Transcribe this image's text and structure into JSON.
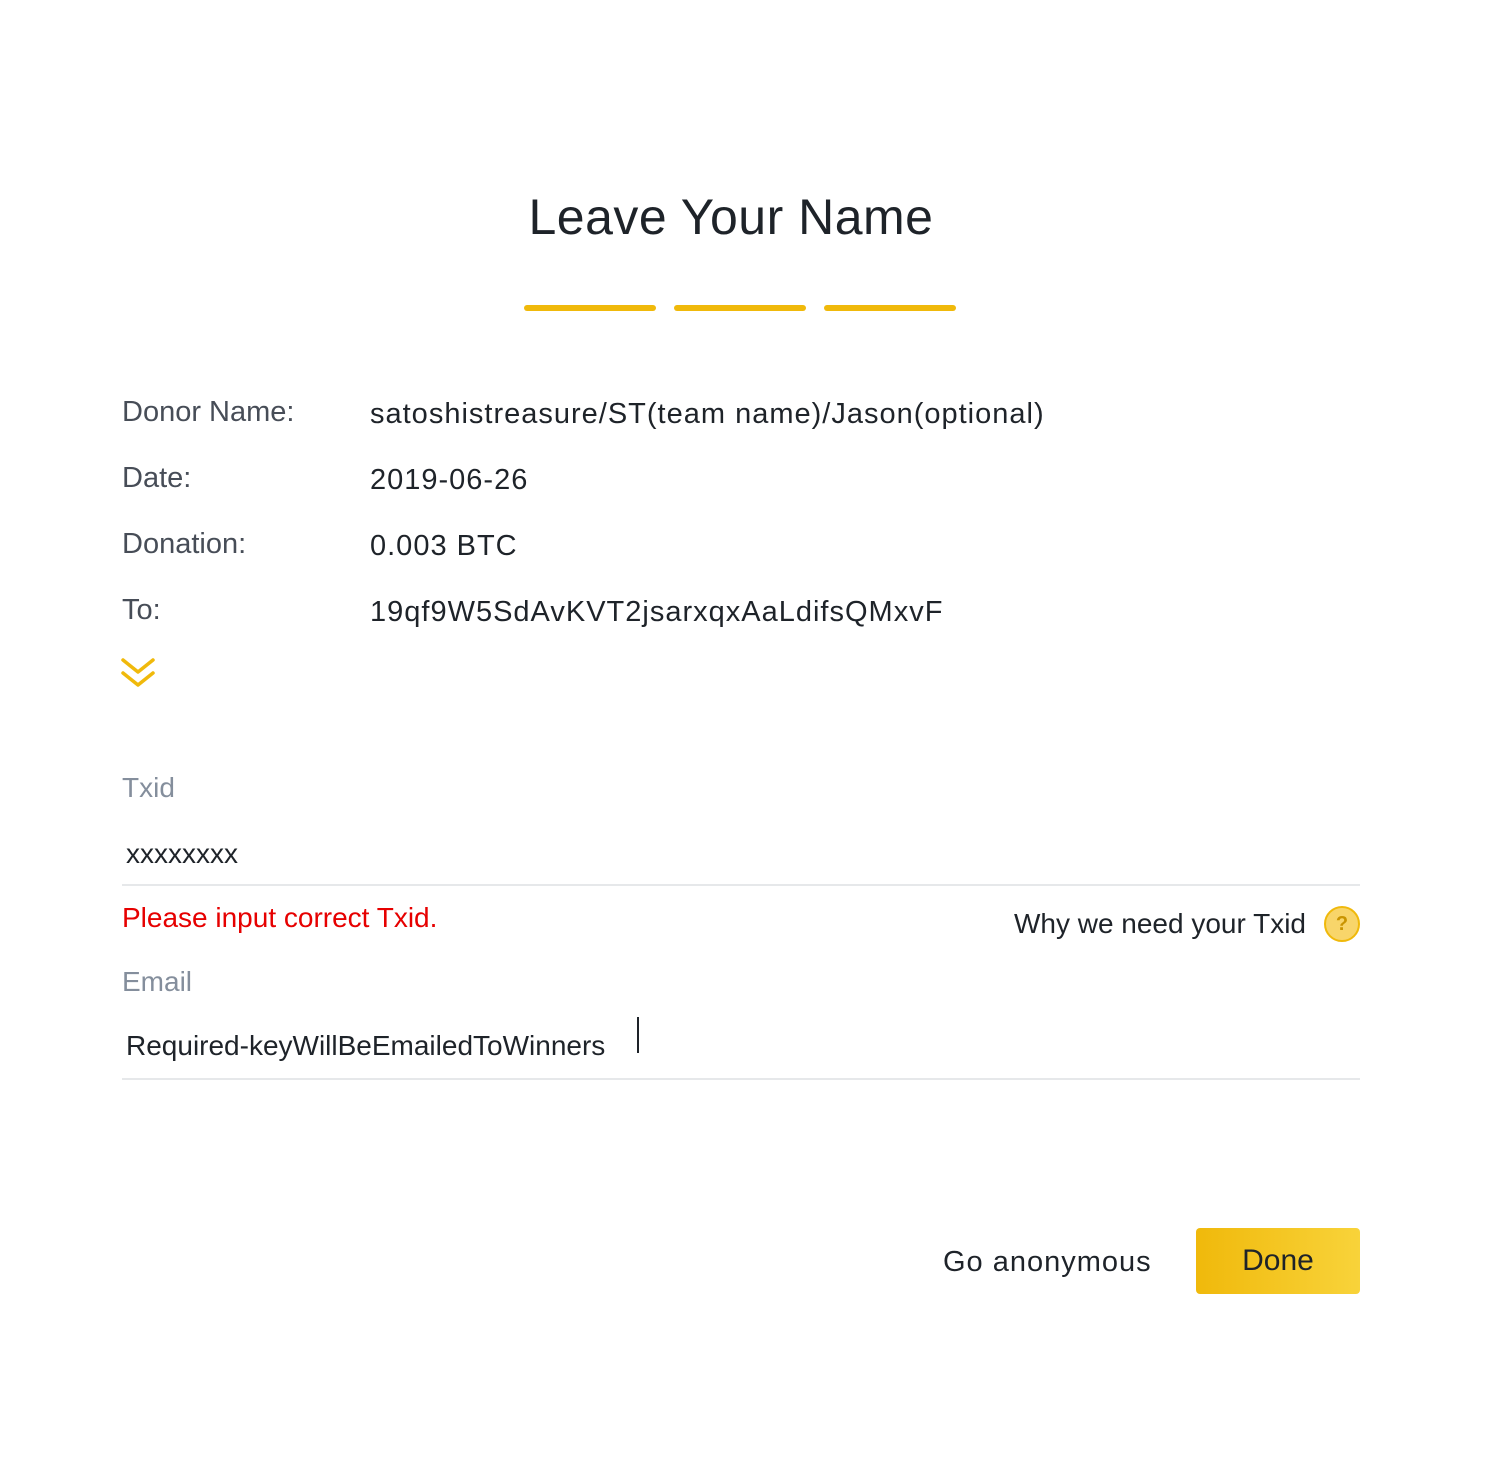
{
  "title": "Leave Your Name",
  "progress": {
    "total_steps": 3,
    "completed_steps": 3,
    "accent_color": "#f0b90b"
  },
  "info": [
    {
      "label": "Donor Name:",
      "value": "satoshistreasure/ST(team name)/Jason(optional)"
    },
    {
      "label": "Date:",
      "value": "2019-06-26"
    },
    {
      "label": "Donation:",
      "value": "0.003 BTC"
    },
    {
      "label": "To:",
      "value": "19qf9W5SdAvKVT2jsarxqxAaLdifsQMxvF"
    }
  ],
  "expand_icon": "double-chevron-down-icon",
  "txid": {
    "label": "Txid",
    "value": "xxxxxxxx",
    "error": "Please input correct Txid.",
    "help_text": "Why we need your Txid",
    "help_icon": "question-circle-icon",
    "error_color": "#e60000"
  },
  "email": {
    "label": "Email",
    "value": "Required-keyWillBeEmailedToWinners"
  },
  "actions": {
    "anonymous_label": "Go anonymous",
    "done_label": "Done"
  }
}
